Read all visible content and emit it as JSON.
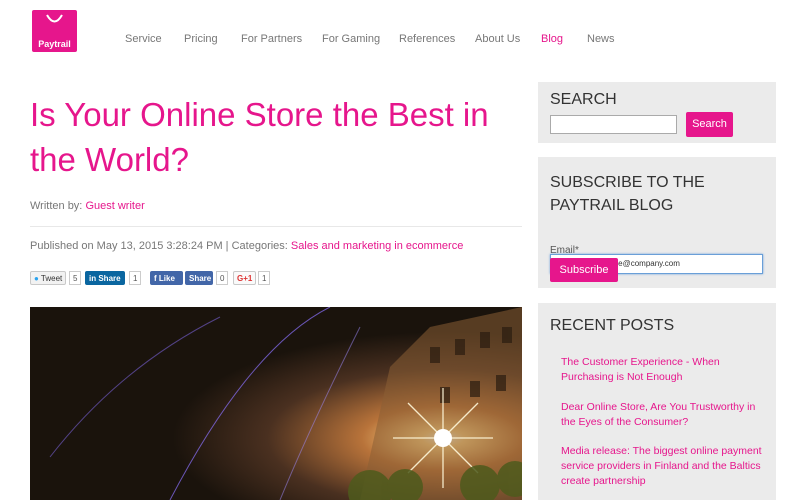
{
  "header": {
    "logo_text": "Paytrail",
    "nav": [
      "Service",
      "Pricing",
      "For Partners",
      "For Gaming",
      "References",
      "About Us",
      "Blog",
      "News"
    ],
    "active": "Blog"
  },
  "article": {
    "title": "Is Your Online Store the Best in the World?",
    "written_label": "Written by:",
    "author": "Guest writer",
    "published": "Published on May 13, 2015 3:28:24 PM | Categories:",
    "category": "Sales and marketing in ecommerce",
    "social": {
      "tweet": "Tweet",
      "tweet_count": "5",
      "linkedin": "Share",
      "linkedin_count": "1",
      "fb_like": "Like",
      "fb_share": "Share",
      "fb_count": "0",
      "gplus": "G+1",
      "gplus_count": "1"
    }
  },
  "sidebar": {
    "search": {
      "heading": "SEARCH",
      "button": "Search",
      "value": ""
    },
    "subscribe": {
      "heading": "SUBSCRIBE TO THE PAYTRAIL BLOG",
      "email_label": "Email*",
      "email_value": "firstname.lastname@company.com",
      "button": "Subscribe"
    },
    "recent": {
      "heading": "RECENT POSTS",
      "posts": [
        "The Customer Experience - When Purchasing is Not Enough",
        "Dear Online Store, Are You Trustworthy in the Eyes of the Consumer?",
        "Media release: The biggest online payment service providers in Finland and the Baltics create partnership"
      ]
    }
  },
  "colors": {
    "accent": "#e6168c",
    "sidebar_bg": "#ebebeb"
  }
}
